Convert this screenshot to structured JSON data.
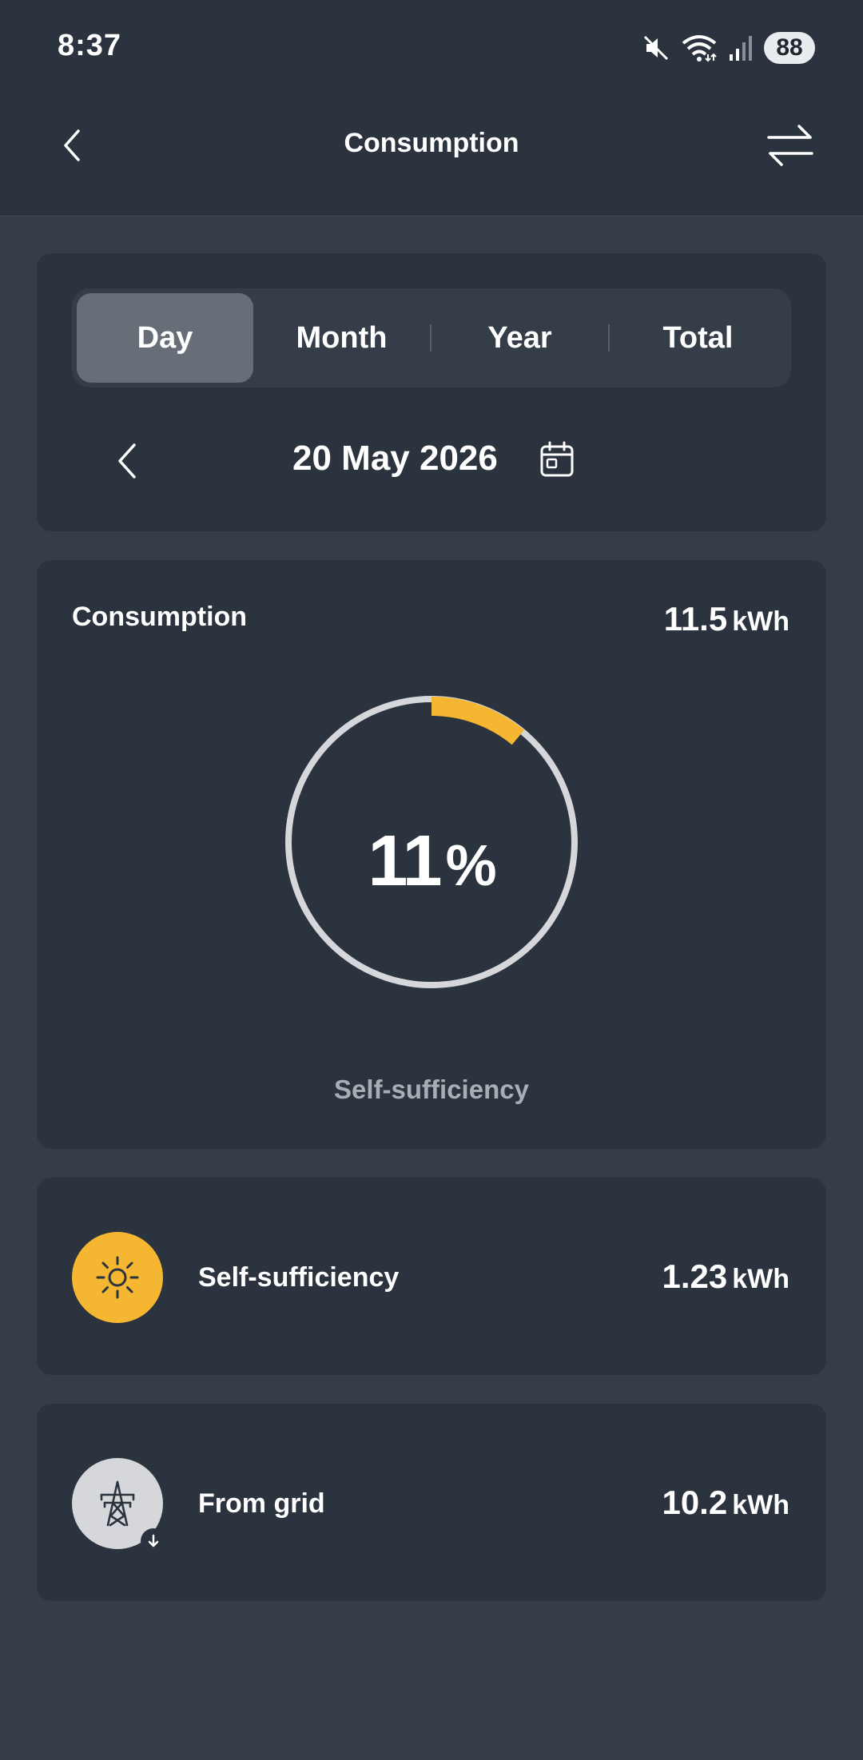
{
  "status_bar": {
    "time": "8:37",
    "battery": "88",
    "icons": [
      "mute-icon",
      "wifi-icon",
      "signal-icon",
      "battery-icon"
    ]
  },
  "header": {
    "title": "Consumption",
    "back_icon": "chevron-left-icon",
    "swap_icon": "swap-arrows-icon"
  },
  "period_selector": {
    "tabs": [
      {
        "label": "Day",
        "active": true
      },
      {
        "label": "Month",
        "active": false
      },
      {
        "label": "Year",
        "active": false
      },
      {
        "label": "Total",
        "active": false
      }
    ],
    "date": "20 May 2026"
  },
  "consumption": {
    "title": "Consumption",
    "value": "11.5",
    "unit": "kWh",
    "percent": "11",
    "percent_sign": "%",
    "percent_fraction": 0.11,
    "caption": "Self-sufficiency"
  },
  "rows": [
    {
      "label": "Self-sufficiency",
      "value": "1.23",
      "unit": "kWh",
      "icon": "sun-icon"
    },
    {
      "label": "From grid",
      "value": "10.2",
      "unit": "kWh",
      "icon": "power-pylon-icon"
    }
  ],
  "colors": {
    "accent": "#f5b731",
    "background": "#363d46",
    "card": "#2b333e",
    "ring_track": "#d5d7da"
  }
}
